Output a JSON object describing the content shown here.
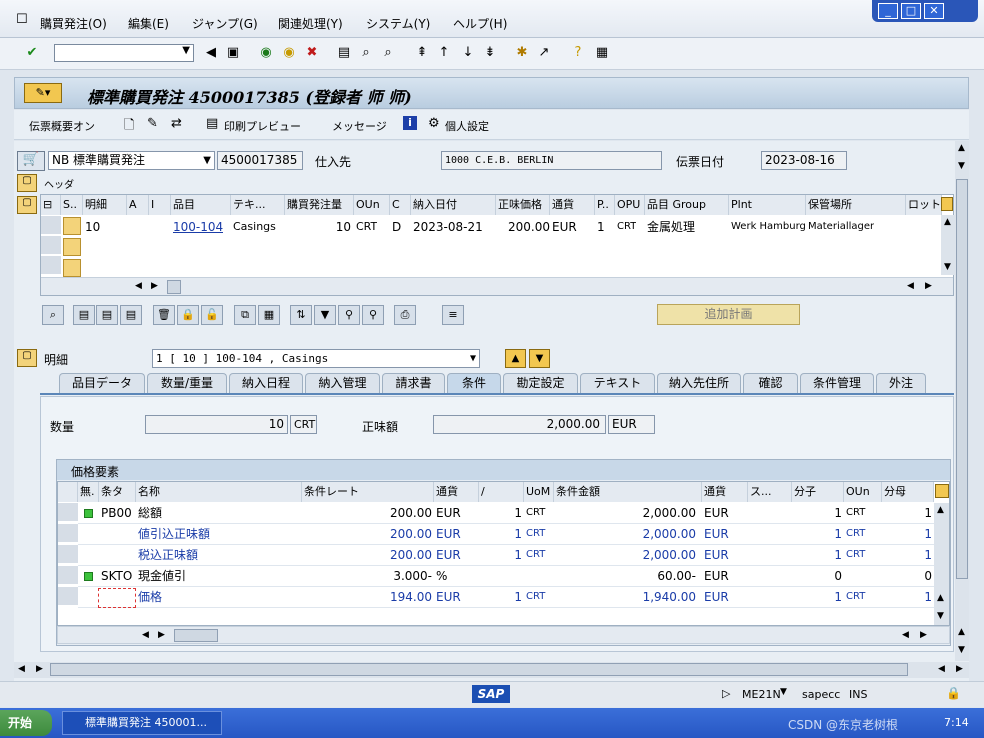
{
  "menu": [
    "購買発注(O)",
    "編集(E)",
    "ジャンプ(G)",
    "関連処理(Y)",
    "システム(Y)",
    "ヘルプ(H)"
  ],
  "window_controls": [
    "_",
    "□",
    "✕"
  ],
  "title": "標準購買発注 4500017385 (登録者 师 师)",
  "app_toolbar": {
    "doc_overview": "伝票概要オン",
    "print_preview": "印刷プレビュー",
    "messages": "メッセージ",
    "personal_settings": "個人設定"
  },
  "header": {
    "order_type": "NB 標準購買発注",
    "po_number": "4500017385",
    "vendor_label": "仕入先",
    "vendor": "1000 C.E.B. BERLIN",
    "doc_date_label": "伝票日付",
    "doc_date": "2023-08-16",
    "header_label": "ヘッダ"
  },
  "items_table": {
    "columns": [
      "S..",
      "明細",
      "A",
      "I",
      "品目",
      "テキ...",
      "購買発注量",
      "OUn",
      "C",
      "納入日付",
      "正味価格",
      "通貨",
      "P..",
      "OPU",
      "品目 Group",
      "Plnt",
      "保管場所",
      "ロット"
    ],
    "rows": [
      [
        "",
        "10",
        "",
        "",
        "100-104",
        "Casings",
        "10",
        "CRT",
        "D",
        "2023-08-21",
        "200.00",
        "EUR",
        "1",
        "CRT",
        "金属処理",
        "Werk Hamburg",
        "Materiallager",
        ""
      ]
    ]
  },
  "plan_button": "追加計画",
  "item_detail": {
    "label": "明細",
    "selected": "1 [ 10 ] 100-104 , Casings"
  },
  "tabs": [
    "品目データ",
    "数量/重量",
    "納入日程",
    "納入管理",
    "請求書",
    "条件",
    "勘定設定",
    "テキスト",
    "納入先住所",
    "確認",
    "条件管理",
    "外注"
  ],
  "active_tab": "条件",
  "conditions": {
    "qty_label": "数量",
    "qty": "10",
    "qty_unit": "CRT",
    "net_label": "正味額",
    "net": "2,000.00",
    "net_currency": "EUR",
    "section_title": "価格要素",
    "columns": [
      "無.",
      "条タ",
      "名称",
      "条件レート",
      "通貨",
      "/",
      "UoM",
      "条件金額",
      "通貨",
      "ス...",
      "分子",
      "OUn",
      "分母"
    ],
    "rows": [
      {
        "status": "green",
        "type": "PB00",
        "name": "総額",
        "rate": "200.00",
        "cur": "EUR",
        "per": "1",
        "uom": "CRT",
        "amount": "2,000.00",
        "cur2": "EUR",
        "num": "1",
        "oun": "CRT",
        "den": "1",
        "blue": false
      },
      {
        "status": "",
        "type": "",
        "name": "値引込正味額",
        "rate": "200.00",
        "cur": "EUR",
        "per": "1",
        "uom": "CRT",
        "amount": "2,000.00",
        "cur2": "EUR",
        "num": "1",
        "oun": "CRT",
        "den": "1",
        "blue": true
      },
      {
        "status": "",
        "type": "",
        "name": "税込正味額",
        "rate": "200.00",
        "cur": "EUR",
        "per": "1",
        "uom": "CRT",
        "amount": "2,000.00",
        "cur2": "EUR",
        "num": "1",
        "oun": "CRT",
        "den": "1",
        "blue": true
      },
      {
        "status": "green",
        "type": "SKTO",
        "name": "現金値引",
        "rate": "3.000-",
        "cur": "%",
        "per": "",
        "uom": "",
        "amount": "60.00-",
        "cur2": "EUR",
        "num": "0",
        "oun": "",
        "den": "0",
        "blue": false
      },
      {
        "status": "",
        "type": "",
        "name": "価格",
        "rate": "194.00",
        "cur": "EUR",
        "per": "1",
        "uom": "CRT",
        "amount": "1,940.00",
        "cur2": "EUR",
        "num": "1",
        "oun": "CRT",
        "den": "1",
        "blue": true
      }
    ]
  },
  "status": {
    "sap_logo": "SAP",
    "transaction": "ME21N",
    "server": "sapecc",
    "mode": "INS"
  },
  "taskbar": {
    "start": "开始",
    "task": "標準購買発注 450001...",
    "watermark": "CSDN @东京老树根",
    "clock": "7:14"
  }
}
